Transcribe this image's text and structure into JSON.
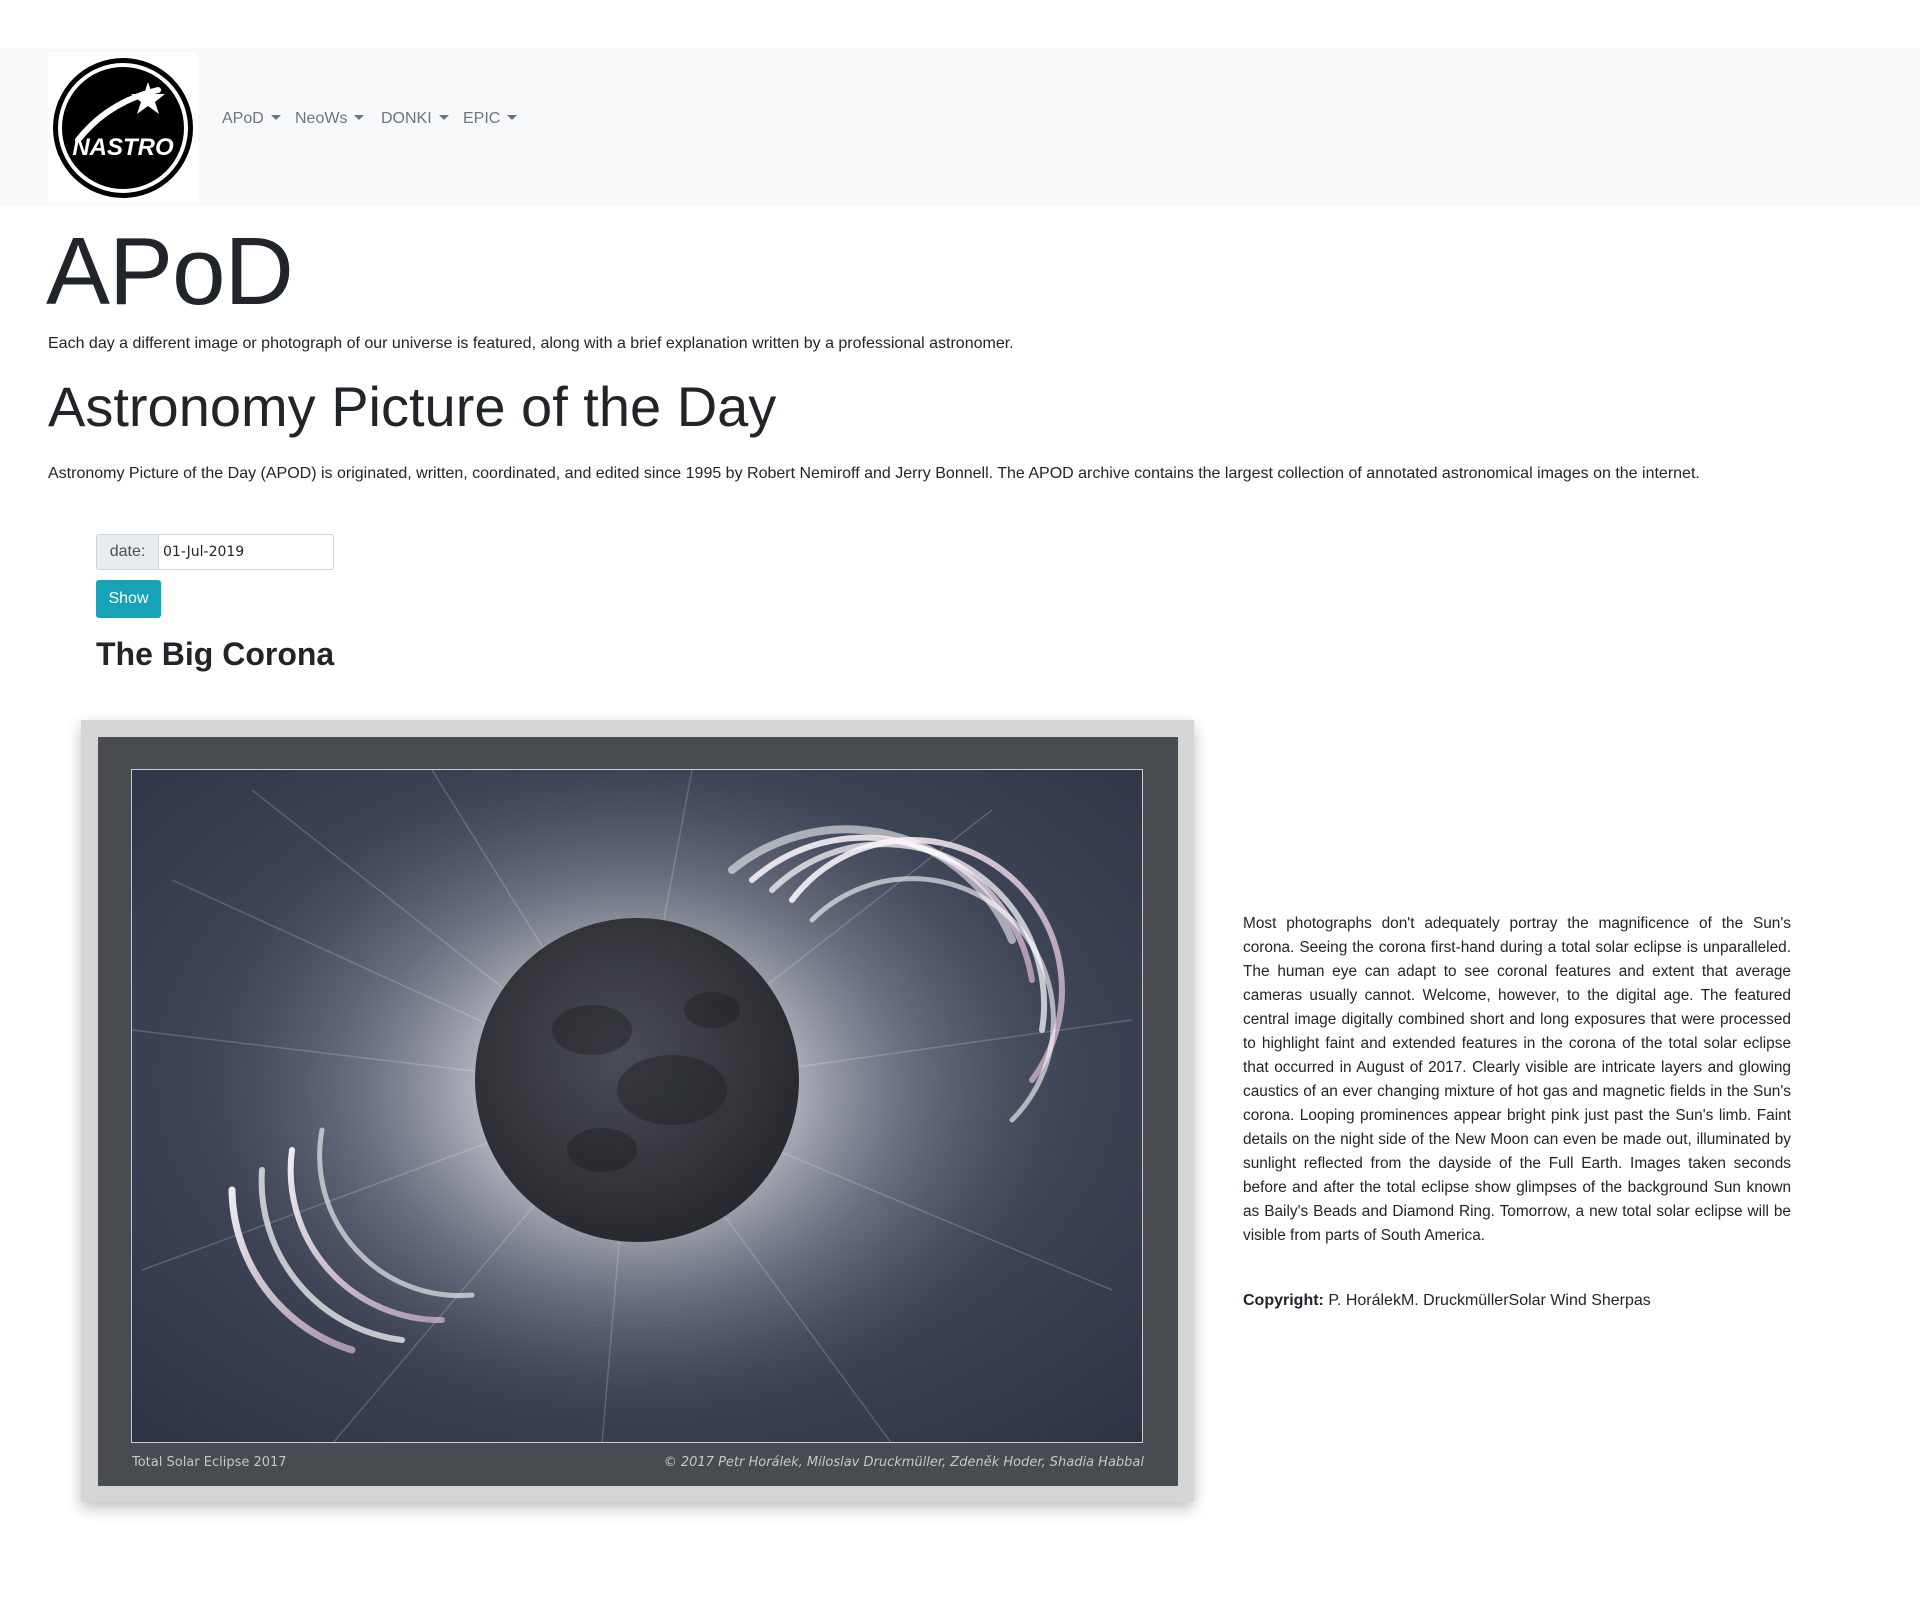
{
  "navbar": {
    "logo_text": "NASTRO",
    "items": [
      {
        "label": "APoD"
      },
      {
        "label": "NeoWs"
      },
      {
        "label": "DONKI"
      },
      {
        "label": "EPIC"
      }
    ]
  },
  "header": {
    "title": "APoD",
    "lead": "Each day a different image or photograph of our universe is featured, along with a brief explanation written by a professional astronomer."
  },
  "section": {
    "title": "Astronomy Picture of the Day",
    "description": "Astronomy Picture of the Day (APOD) is originated, written, coordinated, and edited since 1995 by Robert Nemiroff and Jerry Bonnell. The APOD archive contains the largest collection of annotated astronomical images on the internet."
  },
  "form": {
    "date_label": "date:",
    "date_value": "01-Jul-2019",
    "show_label": "Show"
  },
  "apod": {
    "title": "The Big Corona",
    "image_caption_left": "Total Solar Eclipse 2017",
    "image_caption_right": "© 2017 Petr Horálek, Miloslav Druckmüller, Zdeněk Hoder, Shadia Habbal",
    "explanation": "Most photographs don't adequately portray the magnificence of the Sun's corona. Seeing the corona first-hand during a total solar eclipse is unparalleled. The human eye can adapt to see coronal features and extent that average cameras usually cannot. Welcome, however, to the digital age. The featured central image digitally combined short and long exposures that were processed to highlight faint and extended features in the corona of the total solar eclipse that occurred in August of 2017. Clearly visible are intricate layers and glowing caustics of an ever changing mixture of hot gas and magnetic fields in the Sun's corona. Looping prominences appear bright pink just past the Sun's limb. Faint details on the night side of the New Moon can even be made out, illuminated by sunlight reflected from the dayside of the Full Earth. Images taken seconds before and after the total eclipse show glimpses of the background Sun known as Baily's Beads and Diamond Ring. Tomorrow, a new total solar eclipse will be visible from parts of South America.",
    "copyright_label": "Copyright:",
    "copyright_value": " P. HorálekM. DruckmüllerSolar Wind Sherpas"
  },
  "colors": {
    "navbar_bg": "#f8f9fa",
    "button_info": "#17a2b8",
    "frame_bg": "#484b4f"
  }
}
